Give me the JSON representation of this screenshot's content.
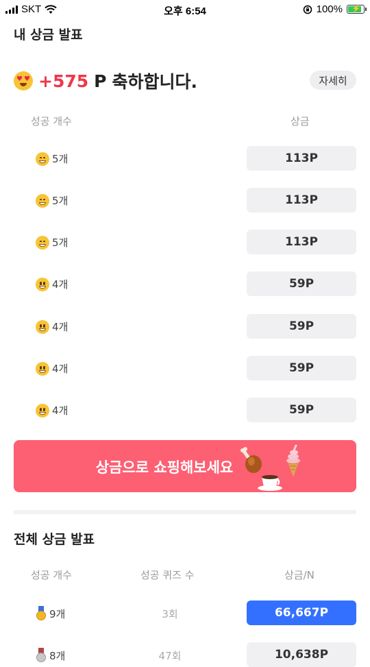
{
  "status_bar": {
    "carrier": "SKT",
    "time": "오후 6:54",
    "battery": "100%"
  },
  "my_prize": {
    "title": "내 상금 발표",
    "amount": "+575",
    "unit": "P",
    "message": "축하합니다.",
    "detail_button": "자세히",
    "col_count": "성공 개수",
    "col_prize": "상금",
    "rows": [
      {
        "count": "5개",
        "prize": "113P",
        "face_icon": "grinning-face-icon"
      },
      {
        "count": "5개",
        "prize": "113P",
        "face_icon": "grinning-face-icon"
      },
      {
        "count": "5개",
        "prize": "113P",
        "face_icon": "grinning-face-icon"
      },
      {
        "count": "4개",
        "prize": "59P",
        "face_icon": "smiley-face-icon"
      },
      {
        "count": "4개",
        "prize": "59P",
        "face_icon": "smiley-face-icon"
      },
      {
        "count": "4개",
        "prize": "59P",
        "face_icon": "smiley-face-icon"
      },
      {
        "count": "4개",
        "prize": "59P",
        "face_icon": "smiley-face-icon"
      }
    ]
  },
  "shop_banner": {
    "label": "상금으로 쇼핑해보세요",
    "color": "#fd5f73"
  },
  "all_prize": {
    "title": "전체 상금 발표",
    "col_count": "성공 개수",
    "col_quiz": "성공 퀴즈 수",
    "col_prize": "상금/N",
    "rows": [
      {
        "count": "9개",
        "quiz": "3회",
        "prize": "66,667P",
        "medal": "gold-medal-icon",
        "highlight_color": "#3370ff"
      },
      {
        "count": "8개",
        "quiz": "47회",
        "prize": "10,638P",
        "medal": "silver-medal-icon"
      }
    ]
  }
}
